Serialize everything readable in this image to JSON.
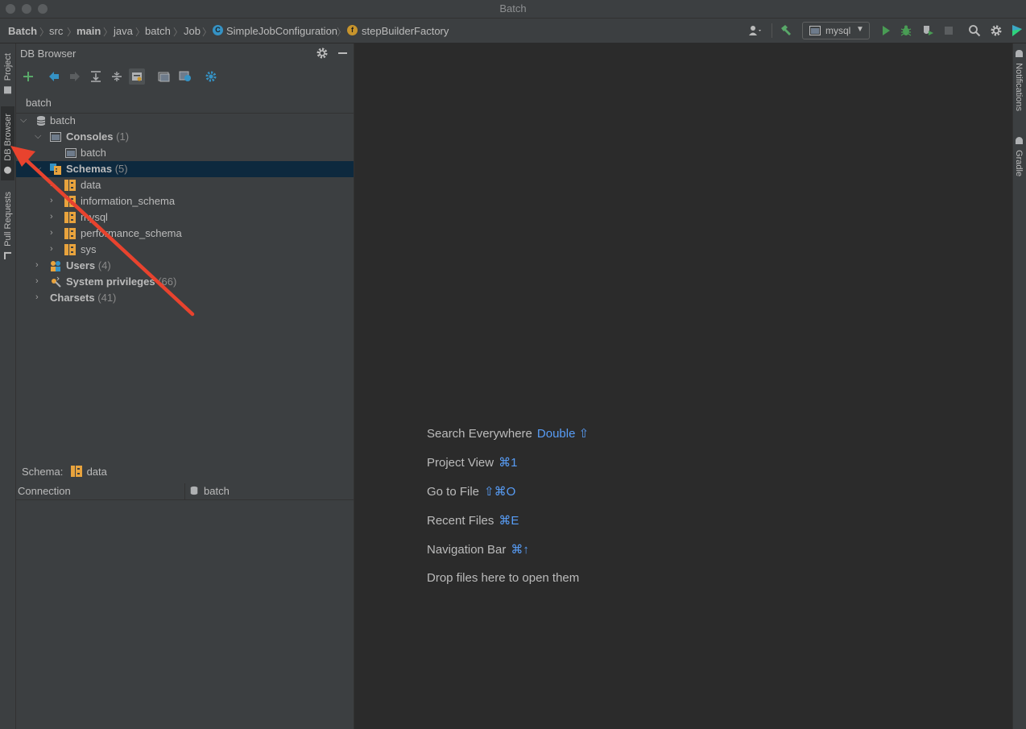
{
  "window": {
    "title": "Batch"
  },
  "breadcrumbs": [
    {
      "label": "Batch",
      "bold": true
    },
    {
      "label": "src",
      "bold": false
    },
    {
      "label": "main",
      "bold": true
    },
    {
      "label": "java",
      "bold": false
    },
    {
      "label": "batch",
      "bold": false
    },
    {
      "label": "Job",
      "bold": false
    },
    {
      "label": "SimpleJobConfiguration",
      "bold": false
    },
    {
      "label": "stepBuilderFactory",
      "bold": false
    }
  ],
  "toolbar": {
    "run_config": "mysql"
  },
  "left_stripe": {
    "project": "Project",
    "db_browser": "DB Browser",
    "pull_requests": "Pull Requests"
  },
  "right_stripe": {
    "notifications": "Notifications",
    "gradle": "Gradle"
  },
  "panel": {
    "title": "DB Browser",
    "connection": "batch",
    "tree": {
      "root": "batch",
      "consoles": {
        "label": "Consoles",
        "count": "(1)",
        "child": "batch"
      },
      "schemas": {
        "label": "Schemas",
        "count": "(5)",
        "items": [
          "data",
          "information_schema",
          "mysql",
          "performance_schema",
          "sys"
        ]
      },
      "users": {
        "label": "Users",
        "count": "(4)"
      },
      "privileges": {
        "label": "System privileges",
        "count": "(66)"
      },
      "charsets": {
        "label": "Charsets",
        "count": "(41)"
      }
    },
    "schema_label": "Schema:",
    "schema_value": "data",
    "props": {
      "col1": "Connection",
      "col2": "batch"
    }
  },
  "editor_hints": [
    {
      "text": "Search Everywhere",
      "key": "Double ⇧"
    },
    {
      "text": "Project View",
      "key": "⌘1"
    },
    {
      "text": "Go to File",
      "key": "⇧⌘O"
    },
    {
      "text": "Recent Files",
      "key": "⌘E"
    },
    {
      "text": "Navigation Bar",
      "key": "⌘↑"
    },
    {
      "text": "Drop files here to open them",
      "key": ""
    }
  ],
  "colors": {
    "accent": "#589df6",
    "selection": "#0d293e",
    "annotation": "#e8432e"
  }
}
